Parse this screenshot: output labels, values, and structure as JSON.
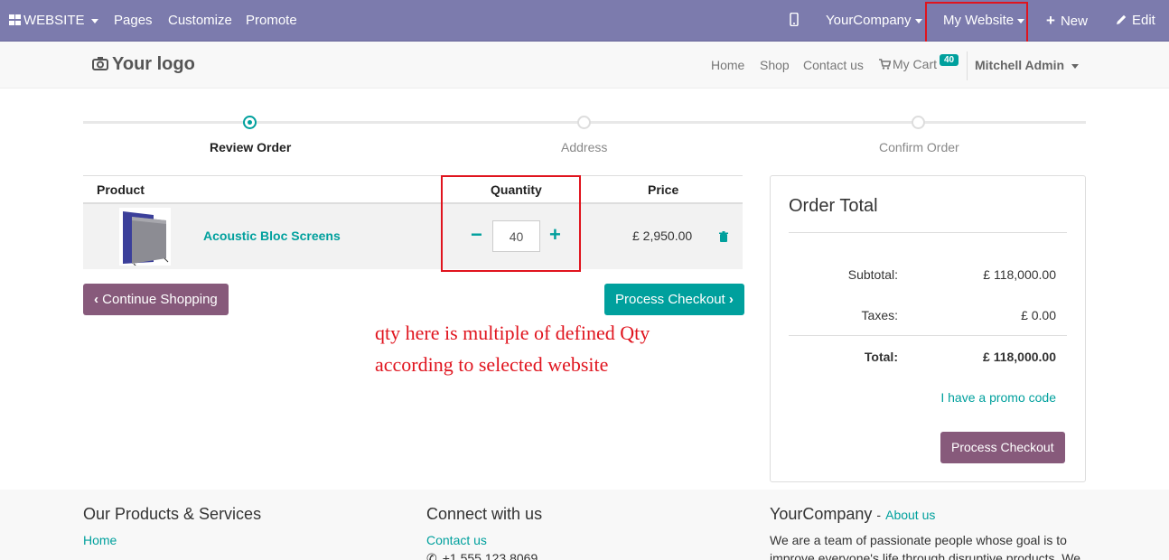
{
  "adminbar": {
    "website_menu": "WEBSITE",
    "pages": "Pages",
    "customize": "Customize",
    "promote": "Promote",
    "company": "YourCompany",
    "my_website": "My Website",
    "new": "New",
    "edit": "Edit"
  },
  "header": {
    "logo": "Your logo",
    "nav": {
      "home": "Home",
      "shop": "Shop",
      "contact": "Contact us",
      "cart": "My Cart",
      "cart_count": "40"
    },
    "user": "Mitchell Admin"
  },
  "steps": [
    {
      "label": "Review Order"
    },
    {
      "label": "Address"
    },
    {
      "label": "Confirm Order"
    }
  ],
  "cart": {
    "headers": {
      "product": "Product",
      "quantity": "Quantity",
      "price": "Price"
    },
    "rows": [
      {
        "product": "Acoustic Bloc Screens",
        "quantity": "40",
        "price": "£ 2,950.00"
      }
    ],
    "minus": "−",
    "plus": "+"
  },
  "buttons": {
    "continue": "Continue Shopping",
    "checkout": "Process Checkout"
  },
  "annotation": {
    "line1": "qty here is multiple of defined Qty",
    "line2": "according to selected website"
  },
  "order_total": {
    "title": "Order Total",
    "subtotal_label": "Subtotal:",
    "subtotal": "£ 118,000.00",
    "taxes_label": "Taxes:",
    "taxes": "£ 0.00",
    "total_label": "Total:",
    "total": "£ 118,000.00",
    "promo": "I have a promo code",
    "checkout": "Process Checkout"
  },
  "footer": {
    "col1_title": "Our Products & Services",
    "col1_link": "Home",
    "col2_title": "Connect with us",
    "col2_link": "Contact us",
    "col2_phone": "+1 555 123 8069",
    "col3_title": "YourCompany",
    "col3_sep": "-",
    "col3_link": "About us",
    "col3_text1": "We are a team of passionate people whose goal is to",
    "col3_text2": "improve everyone's life through disruptive products. We"
  },
  "colors": {
    "adminbar": "#7c7bad",
    "accent": "#00a09d",
    "secondary_button": "#875a7b",
    "annotation": "#e0141e"
  }
}
